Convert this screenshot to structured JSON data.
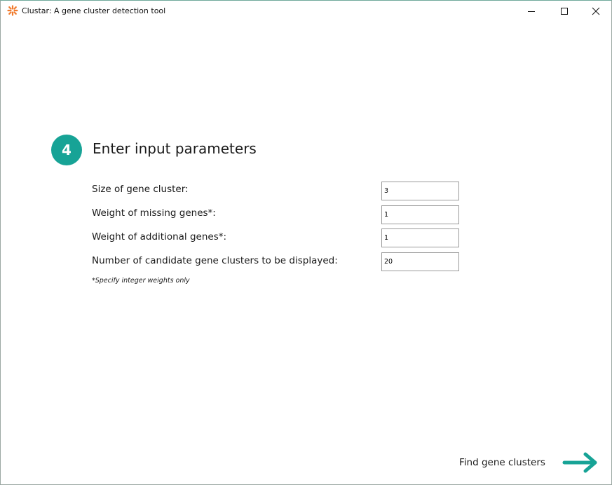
{
  "window": {
    "title": "Clustar: A gene cluster detection tool",
    "controls": {
      "minimize": "—",
      "maximize": "☐",
      "close": "✕"
    }
  },
  "step": {
    "number": "4",
    "title": "Enter input parameters"
  },
  "params": [
    {
      "label": "Size of gene cluster:",
      "value": "3"
    },
    {
      "label": "Weight of missing genes*:",
      "value": "1"
    },
    {
      "label": "Weight of additional genes*:",
      "value": "1"
    },
    {
      "label": "Number of candidate gene clusters to be displayed:",
      "value": "20"
    }
  ],
  "note": "*Specify integer weights only",
  "action": {
    "label": "Find gene clusters",
    "icon": "arrow-right-icon"
  },
  "colors": {
    "accent": "#17a396",
    "app_icon": "#f07b2e"
  }
}
